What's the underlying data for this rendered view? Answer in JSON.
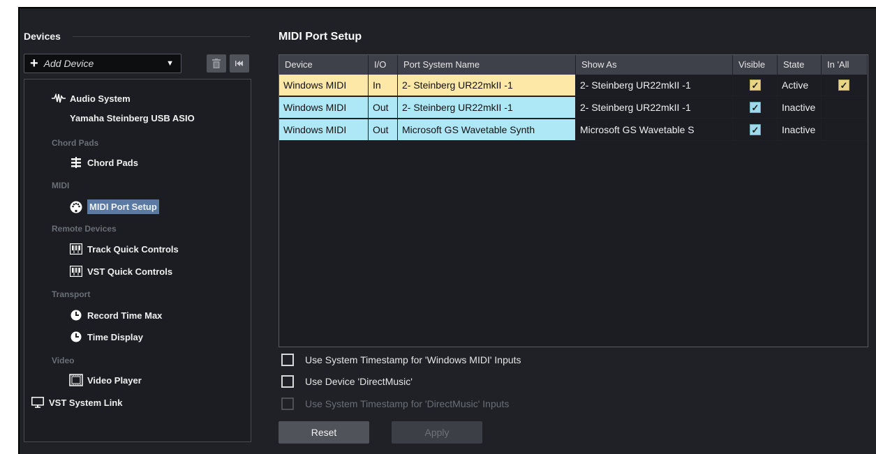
{
  "left_panel": {
    "title": "Devices",
    "add_device_label": "Add Device",
    "tree": [
      {
        "kind": "item",
        "label": "Audio System",
        "icon": "audio-wave-icon"
      },
      {
        "kind": "item",
        "label": "Yamaha Steinberg USB ASIO",
        "icon": ""
      },
      {
        "kind": "category",
        "label": "Chord Pads"
      },
      {
        "kind": "item",
        "label": "Chord Pads",
        "icon": "chord-pads-icon"
      },
      {
        "kind": "category",
        "label": "MIDI"
      },
      {
        "kind": "item",
        "label": "MIDI Port Setup",
        "icon": "midi-plug-icon",
        "selected": true
      },
      {
        "kind": "category",
        "label": "Remote Devices"
      },
      {
        "kind": "item",
        "label": "Track Quick Controls",
        "icon": "keyboard-icon"
      },
      {
        "kind": "item",
        "label": "VST Quick Controls",
        "icon": "keyboard-icon"
      },
      {
        "kind": "category",
        "label": "Transport"
      },
      {
        "kind": "item",
        "label": "Record Time Max",
        "icon": "clock-icon"
      },
      {
        "kind": "item",
        "label": "Time Display",
        "icon": "clock-icon"
      },
      {
        "kind": "category",
        "label": "Video"
      },
      {
        "kind": "item",
        "label": "Video Player",
        "icon": "film-icon"
      },
      {
        "kind": "item",
        "label": "VST System Link",
        "icon": "monitor-icon"
      }
    ]
  },
  "right_panel": {
    "title": "MIDI Port Setup",
    "columns": [
      "Device",
      "I/O",
      "Port System Name",
      "Show As",
      "Visible",
      "State",
      "In 'All MIDI"
    ],
    "rows": [
      {
        "device": "Windows MIDI",
        "io": "In",
        "port": "2- Steinberg UR22mkII -1",
        "show_as": "2- Steinberg UR22mkII -1",
        "visible": true,
        "state": "Active",
        "in_all_midi": true,
        "color": "#fde8a8"
      },
      {
        "device": "Windows MIDI",
        "io": "Out",
        "port": "2- Steinberg UR22mkII -1",
        "show_as": "2- Steinberg UR22mkII -1",
        "visible": true,
        "state": "Inactive",
        "in_all_midi": false,
        "color": "#aee8f6"
      },
      {
        "device": "Windows MIDI",
        "io": "Out",
        "port": "Microsoft GS Wavetable Synth",
        "show_as": "Microsoft GS Wavetable S",
        "visible": true,
        "state": "Inactive",
        "in_all_midi": false,
        "color": "#aee8f6"
      }
    ],
    "options": [
      {
        "label": "Use System Timestamp for 'Windows MIDI' Inputs",
        "checked": false,
        "enabled": true
      },
      {
        "label": "Use Device 'DirectMusic'",
        "checked": false,
        "enabled": true
      },
      {
        "label": "Use System Timestamp for 'DirectMusic' Inputs",
        "checked": false,
        "enabled": false
      }
    ],
    "reset_label": "Reset",
    "apply_label": "Apply"
  },
  "check_glyph": "✓"
}
